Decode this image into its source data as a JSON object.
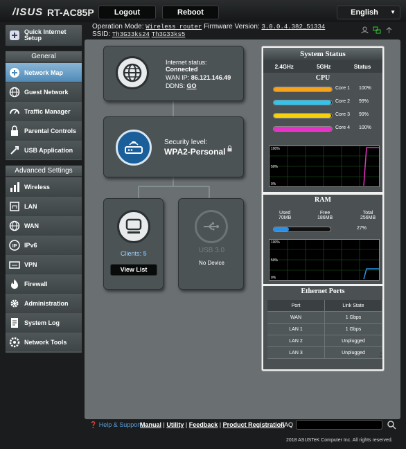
{
  "header": {
    "logo": "/ISUS",
    "model": "RT-AC85P",
    "logout": "Logout",
    "reboot": "Reboot",
    "language": "English",
    "op_mode_label": "Operation Mode:",
    "op_mode": "Wireless router",
    "fw_label": "Firmware Version:",
    "fw": "3.0.0.4.382_51334",
    "ssid_label": "SSID:",
    "ssid1": "Th3G33ks24",
    "ssid2": "Th3G33ks5"
  },
  "sidebar": {
    "quick": "Quick Internet Setup",
    "general": "General",
    "general_items": [
      {
        "label": "Network Map",
        "icon": "network-map-icon"
      },
      {
        "label": "Guest Network",
        "icon": "globe-icon"
      },
      {
        "label": "Traffic Manager",
        "icon": "gauge-icon"
      },
      {
        "label": "Parental Controls",
        "icon": "lock-icon"
      },
      {
        "label": "USB Application",
        "icon": "usb-icon"
      }
    ],
    "advanced": "Advanced Settings",
    "advanced_items": [
      {
        "label": "Wireless",
        "icon": "wifi-icon"
      },
      {
        "label": "LAN",
        "icon": "lan-icon"
      },
      {
        "label": "WAN",
        "icon": "globe-icon"
      },
      {
        "label": "IPv6",
        "icon": "ipv6-icon"
      },
      {
        "label": "VPN",
        "icon": "vpn-icon"
      },
      {
        "label": "Firewall",
        "icon": "fire-icon"
      },
      {
        "label": "Administration",
        "icon": "gear-icon"
      },
      {
        "label": "System Log",
        "icon": "log-icon"
      },
      {
        "label": "Network Tools",
        "icon": "tools-icon"
      }
    ]
  },
  "map": {
    "internet_status_label": "Internet status:",
    "internet_status": "Connected",
    "wan_ip_label": "WAN IP:",
    "wan_ip": "86.121.146.49",
    "ddns_label": "DDNS:",
    "ddns": "GO",
    "security_label": "Security level:",
    "security": "WPA2-Personal",
    "clients_label": "Clients:",
    "clients": "5",
    "view_list": "View List",
    "usb_label": "USB 3.0",
    "usb_status": "No Device"
  },
  "system": {
    "title": "System Status",
    "tabs": [
      "2.4GHz",
      "5GHz",
      "Status"
    ],
    "cpu_title": "CPU",
    "cores": [
      {
        "label": "Core 1",
        "value": "100%",
        "fraction": 1.0,
        "color": "#f7a21b"
      },
      {
        "label": "Core 2",
        "value": "99%",
        "fraction": 0.99,
        "color": "#2ec6f0"
      },
      {
        "label": "Core 3",
        "value": "99%",
        "fraction": 0.99,
        "color": "#f5d20c"
      },
      {
        "label": "Core 4",
        "value": "100%",
        "fraction": 1.0,
        "color": "#e831c6"
      }
    ],
    "graph_ticks": [
      "100%",
      "50%",
      "0%"
    ],
    "ram_title": "RAM",
    "ram_used_label": "Used",
    "ram_used": "70MB",
    "ram_free_label": "Free",
    "ram_free": "186MB",
    "ram_total_label": "Total",
    "ram_total": "256MB",
    "ram_pct": "27%",
    "ram_fraction": 0.27,
    "eth_title": "Ethernet Ports",
    "eth_headers": [
      "Port",
      "Link State"
    ],
    "eth_rows": [
      [
        "WAN",
        "1 Gbps"
      ],
      [
        "LAN 1",
        "1 Gbps"
      ],
      [
        "LAN 2",
        "Unplugged"
      ],
      [
        "LAN 3",
        "Unplugged"
      ]
    ]
  },
  "footer": {
    "help": "Help & Support",
    "manual": "Manual",
    "utility": "Utility",
    "feedback": "Feedback",
    "product_reg": "Product Registration",
    "faq": "FAQ",
    "copyright": "2018 ASUSTeK Computer Inc. All rights reserved."
  }
}
